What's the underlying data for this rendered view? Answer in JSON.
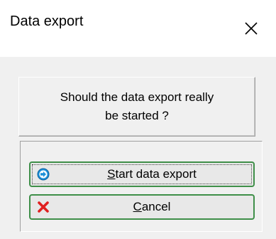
{
  "window": {
    "title": "Data export",
    "close_glyph": "✕"
  },
  "message": {
    "text": "Should the data export really be started ?"
  },
  "buttons": {
    "start": {
      "mnemonic": "S",
      "rest": "tart data export",
      "icon": "blue-arrow-right-icon"
    },
    "cancel": {
      "mnemonic": "C",
      "rest": "ancel",
      "icon": "red-x-icon"
    }
  },
  "colors": {
    "button_border": "#3f8f49",
    "cancel_icon": "#e02020",
    "start_icon": "#1e90d8"
  }
}
